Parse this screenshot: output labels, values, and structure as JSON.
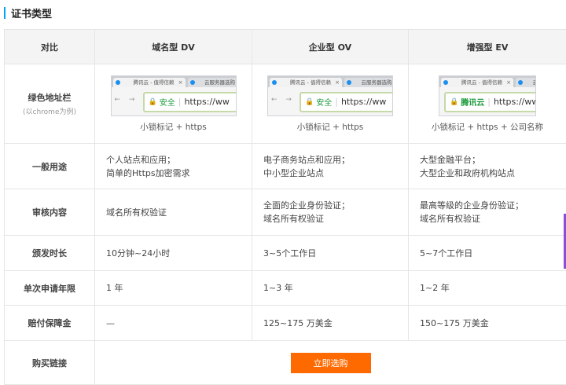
{
  "section": {
    "title": "证书类型"
  },
  "table": {
    "corner": "对比",
    "columns": [
      "域名型 DV",
      "企业型 OV",
      "增强型 EV"
    ],
    "address_bar": {
      "label": "绿色地址栏",
      "sublabel": "(以chrome为例)",
      "tab1": "腾讯云 - 值得信赖",
      "tab2": "云服务器选购",
      "nav": "← → C",
      "url": "https://ww",
      "secure_dv": "安全",
      "secure_ov": "安全",
      "secure_ev": "腾讯云",
      "caption_dv": "小锁标记 + https",
      "caption_ov": "小锁标记 + https",
      "caption_ev": "小锁标记 + https + 公司名称"
    },
    "rows": [
      {
        "label": "一般用途",
        "values": [
          [
            "个人站点和应用；",
            "简单的Https加密需求"
          ],
          [
            "电子商务站点和应用；",
            "中小型企业站点"
          ],
          [
            "大型金融平台；",
            "大型企业和政府机构站点"
          ]
        ]
      },
      {
        "label": "审核内容",
        "values": [
          [
            "域名所有权验证"
          ],
          [
            "全面的企业身份验证；",
            "域名所有权验证"
          ],
          [
            "最高等级的企业身份验证；",
            "域名所有权验证"
          ]
        ]
      },
      {
        "label": "颁发时长",
        "values": [
          [
            "10分钟~24小时"
          ],
          [
            "3~5个工作日"
          ],
          [
            "5~7个工作日"
          ]
        ]
      },
      {
        "label": "单次申请年限",
        "values": [
          [
            "1 年"
          ],
          [
            "1~3 年"
          ],
          [
            "1~2 年"
          ]
        ]
      },
      {
        "label": "赔付保障金",
        "values": [
          [
            "—"
          ],
          [
            "125~175 万美金"
          ],
          [
            "150~175 万美金"
          ]
        ]
      }
    ],
    "buy": {
      "label": "购买链接",
      "button": "立即选购"
    }
  }
}
